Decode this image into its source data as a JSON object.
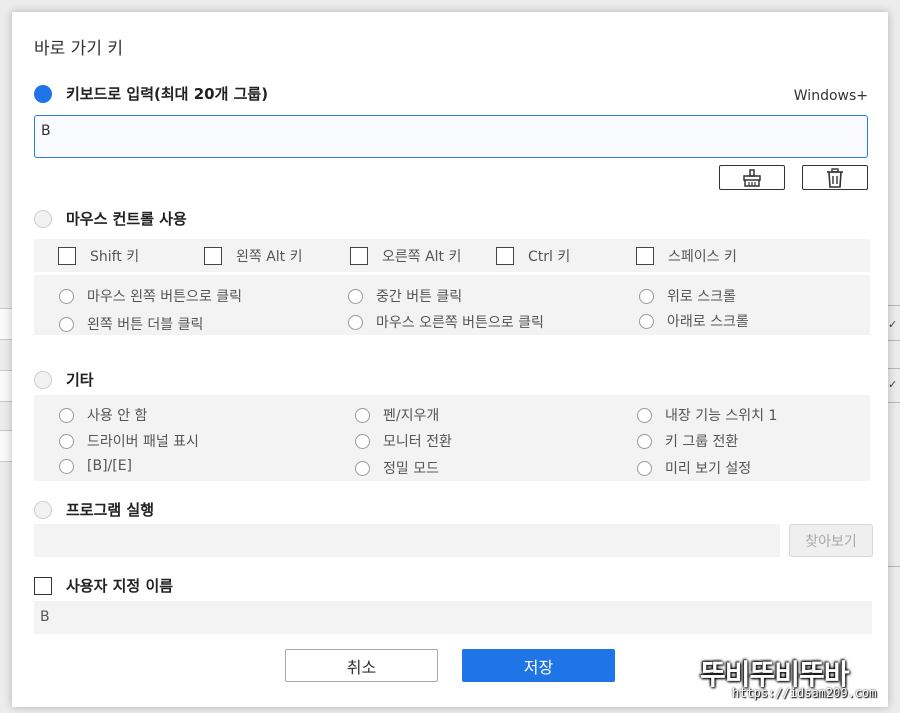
{
  "dialog": {
    "title": "바로 가기 키"
  },
  "keyboard": {
    "label": "키보드로 입력(최대 20개 그룹)",
    "prefix": "Windows+",
    "value": "B"
  },
  "mouse": {
    "label": "마우스 컨트롤 사용",
    "modifiers": [
      "Shift 키",
      "왼쪽 Alt 키",
      "오른쪽 Alt 키",
      "Ctrl 키",
      "스페이스 키"
    ],
    "actions": [
      "마우스 왼쪽 버튼으로 클릭",
      "중간 버튼 클릭",
      "위로 스크롤",
      "왼쪽 버튼 더블 클릭",
      "마우스 오른쪽 버튼으로 클릭",
      "아래로 스크롤"
    ]
  },
  "other": {
    "label": "기타",
    "options": [
      "사용 안 함",
      "펜/지우개",
      "내장 기능 스위치 1",
      "드라이버 패널 표시",
      "모니터 전환",
      "키 그룹 전환",
      "[B]/[E]",
      "정밀 모드",
      "미리 보기 설정"
    ]
  },
  "program": {
    "label": "프로그램 실행",
    "browse_label": "찾아보기"
  },
  "custom_name": {
    "label": "사용자 지정 이름",
    "value": "B"
  },
  "buttons": {
    "cancel": "취소",
    "save": "저장"
  },
  "watermark": {
    "main": "뚜비뚜비뚜바",
    "url": "https://idsam209.com"
  },
  "colors": {
    "accent": "#1f74e8",
    "panel": "#f3f3f3"
  }
}
